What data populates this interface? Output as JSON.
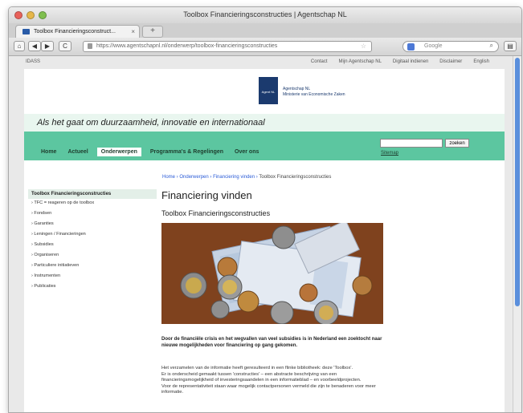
{
  "window": {
    "title": "Toolbox Financieringsconstructies | Agentschap NL",
    "tab_label": "Toolbox Financieringsconstruct...",
    "tab_close": "×",
    "new_tab": "+"
  },
  "navbar": {
    "back_icon": "◀",
    "forward_icon": "▶",
    "reload_icon": "C",
    "home_icon": "⌂",
    "url": "https://www.agentschapnl.nl/onderwerp/toolbox-financieringsconstructies",
    "star_icon": "☆",
    "search_placeholder": "Google",
    "search_icon": "🔍",
    "menu_icon": "▤"
  },
  "utility": {
    "left": "IDASS",
    "links": [
      "Contact",
      "Mijn Agentschap NL",
      "Digitaal indienen",
      "Disclaimer",
      "English"
    ]
  },
  "logo": {
    "box_text": "Agent NL",
    "org": "Agentschap NL",
    "ministry": "Ministerie van Economische Zaken"
  },
  "tagline": "Als het gaat om duurzaamheid, innovatie en internationaal",
  "menu": {
    "items": [
      "Home",
      "Actueel",
      "Onderwerpen",
      "Programma's & Regelingen",
      "Over ons"
    ]
  },
  "search": {
    "button": "zoeken",
    "sitemap": "Sitemap"
  },
  "breadcrumb": {
    "items": [
      "Home",
      "Onderwerpen",
      "Financiering vinden"
    ],
    "current": "Toolbox Financieringsconstructies"
  },
  "sidenav": {
    "active": "Toolbox Financieringsconstructies",
    "items": [
      "TFC = reageren op de toolbox",
      "Fondsen",
      "Garanties",
      "Leningen / Financieringen",
      "Subsidies",
      "Organiseren",
      "Particuliere initiatieven",
      "Instrumenten",
      "Publicaties"
    ]
  },
  "main": {
    "heading": "Financiering vinden",
    "subheading": "Toolbox Financieringsconstructies",
    "lead": "Door de financiële crisis en het wegvallen van veel subsidies is in Nederland een zoektocht naar nieuwe mogelijkheden voor financiering op gang gekomen.",
    "body_1": "Het verzamelen van de informatie heeft geresulteerd in een flinke bibliotheek: deze 'Toolbox'.",
    "body_2": "Er is onderscheid gemaakt tussen 'constructies' – een abstracte beschrijving van een financieringsmogelijkheid of investeringsaandelen in een informatieblad – en voorbeeldprojecten.",
    "body_3": "Voor de representativiteit staan waar mogelijk contactpersonen vermeld die zijn te benaderen voor meer informatie."
  }
}
